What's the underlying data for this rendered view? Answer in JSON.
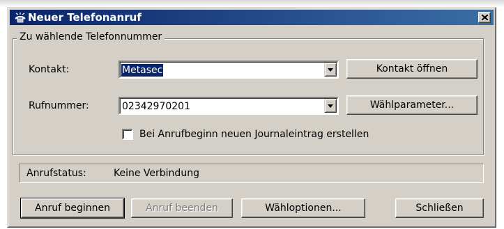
{
  "window": {
    "title": "Neuer Telefonanruf",
    "close_label": "close"
  },
  "group": {
    "legend": "Zu wählende Telefonnummer",
    "contact_label": "Kontakt:",
    "contact_value": "Metasec",
    "number_label": "Rufnummer:",
    "number_value": "02342970201",
    "open_contact_button": "Kontakt öffnen",
    "dial_params_button": "Wählparameter...",
    "journal_checkbox_label": "Bei Anrufbeginn neuen Journaleintrag erstellen",
    "journal_checked": false
  },
  "status": {
    "label": "Anrufstatus:",
    "value": "Keine Verbindung"
  },
  "buttons": {
    "start_call": "Anruf beginnen",
    "end_call": "Anruf beenden",
    "dial_options": "Wähloptionen...",
    "close": "Schließen"
  },
  "colors": {
    "titlebar_start": "#0a246a",
    "titlebar_end": "#3a6ea5",
    "face": "#d4d0c8"
  },
  "icons": {
    "title_icon": "telephone-icon",
    "close": "close-icon",
    "dropdown": "chevron-down-icon"
  }
}
